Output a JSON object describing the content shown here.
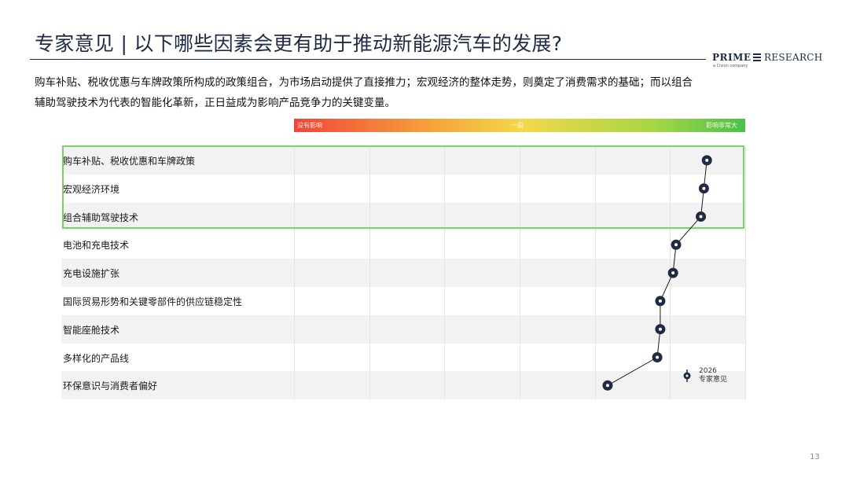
{
  "header": {
    "title": "专家意见 | 以下哪些因素会更有助于推动新能源汽车的发展?",
    "logo_prime": "PRIME",
    "logo_research": "RESEARCH",
    "logo_sub": "a Cision company"
  },
  "intro": "购车补贴、税收优惠与车牌政策所构成的政策组合，为市场启动提供了直接推力；宏观经济的整体走势，则奠定了消费需求的基础；而以组合辅助驾驶技术为代表的智能化革新，正日益成为影响产品竞争力的关键变量。",
  "scale": {
    "left": "没有影响",
    "mid": "一般",
    "right": "影响非常大"
  },
  "legend": {
    "year": "2026",
    "label": "专家意见"
  },
  "page_number": "13",
  "colors": {
    "navy": "#1f2a44",
    "highlight_border": "#7cd26a",
    "row_shade": "#f2f2f2"
  },
  "chart_data": {
    "type": "scatter",
    "title": "专家意见 | 以下哪些因素会更有助于推动新能源汽车的发展?",
    "xlabel": "",
    "ylabel": "",
    "x_scale_labels": [
      "没有影响",
      "一般",
      "影响非常大"
    ],
    "xlim": [
      0,
      6
    ],
    "grid": true,
    "categories": [
      "购车补贴、税收优惠和车牌政策",
      "宏观经济环境",
      "组合辅助驾驶技术",
      "电池和充电技术",
      "充电设施扩张",
      "国际贸易形势和关键零部件的供应链稳定性",
      "智能座舱技术",
      "多样化的产品线",
      "环保意识与消费者偏好"
    ],
    "series": [
      {
        "name": "2026 专家意见",
        "values": [
          5.49,
          5.45,
          5.41,
          5.08,
          5.04,
          4.87,
          4.87,
          4.83,
          4.17
        ]
      }
    ],
    "highlighted_categories": [
      "购车补贴、税收优惠和车牌政策",
      "宏观经济环境",
      "组合辅助驾驶技术"
    ]
  }
}
